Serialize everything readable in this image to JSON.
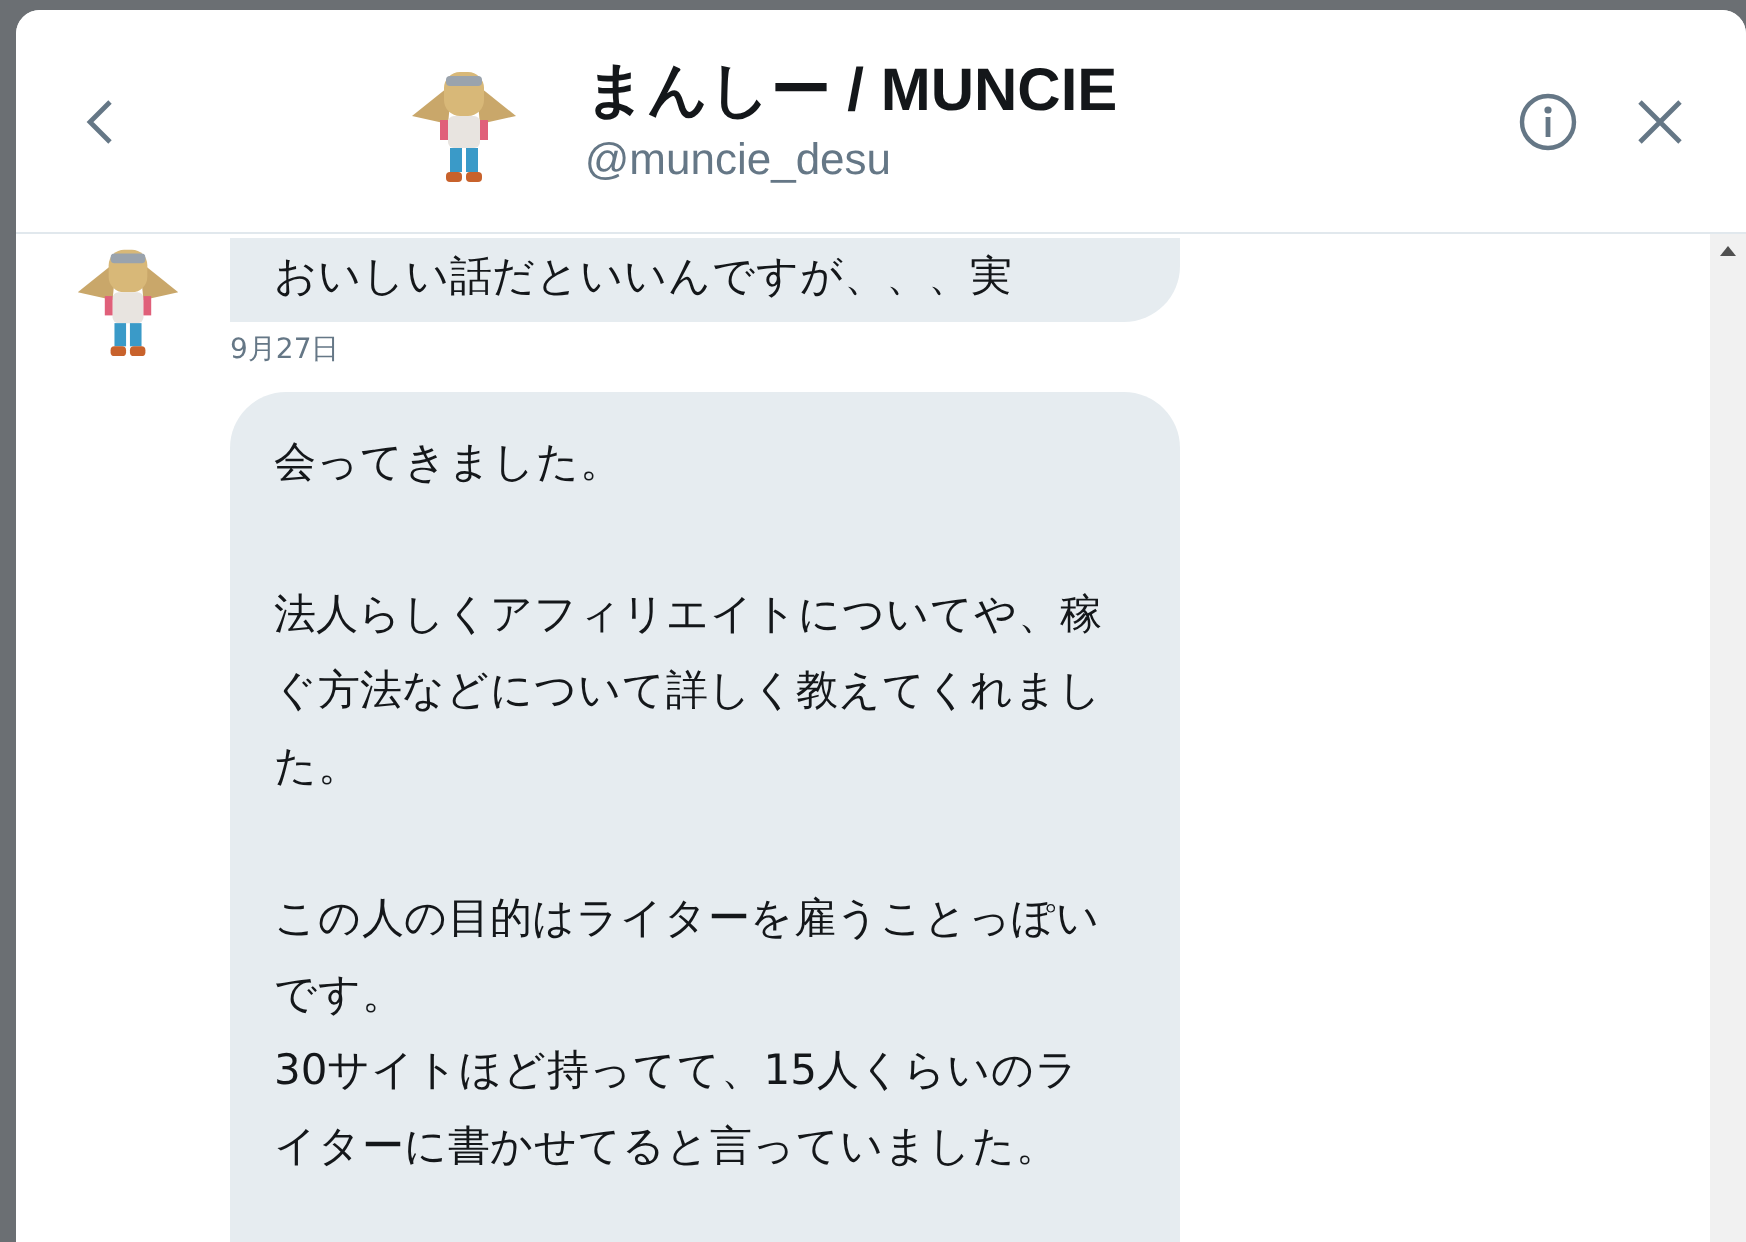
{
  "header": {
    "name": "まんしー / MUNCIE",
    "handle": "@muncie_desu"
  },
  "messages": [
    {
      "paragraphs": [
        [
          "おいしい話だといいんですが、、、実"
        ]
      ],
      "date": "9月27日"
    },
    {
      "paragraphs": [
        [
          "会ってきました。"
        ],
        [
          "法人らしくアフィリエイトについてや、稼ぐ方法などについて詳しく教えてくれました。"
        ],
        [
          "この人の目的はライターを雇うことっぽいです。",
          "30サイトほど持ってて、15人くらいのライターに書かせてると言っていました。"
        ]
      ]
    }
  ]
}
